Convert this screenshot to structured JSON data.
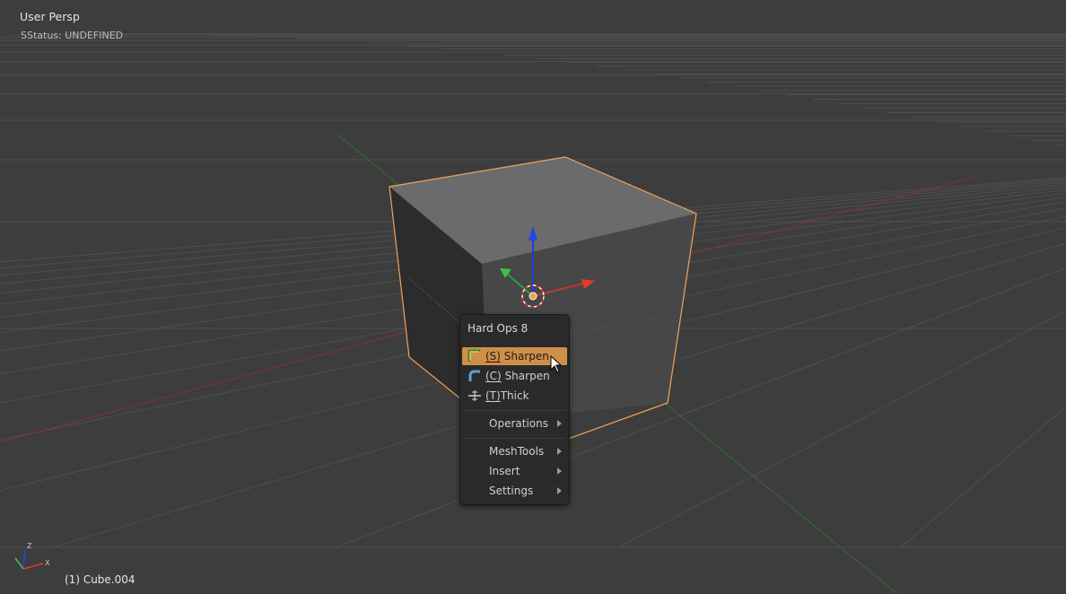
{
  "viewport": {
    "view_name": "User Persp",
    "status": "SStatus: UNDEFINED",
    "object": "(1) Cube.004",
    "axis_labels": {
      "z": "Z",
      "x": "X"
    }
  },
  "menu": {
    "title": "Hard Ops 8",
    "items": [
      {
        "key": "(S)",
        "label": " Sharpen",
        "icon": "sharpen-s-icon",
        "active": true
      },
      {
        "key": "(C)",
        "label": " Sharpen",
        "icon": "sharpen-c-icon",
        "active": false
      },
      {
        "key": "(T)",
        "label": "Thick",
        "icon": "thick-icon",
        "active": false
      }
    ],
    "submenus": [
      {
        "label": "Operations"
      },
      {
        "label": "MeshTools"
      },
      {
        "label": "Insert"
      },
      {
        "label": "Settings"
      }
    ]
  },
  "colors": {
    "background": "#3d3d3d",
    "grid": "#4d4d4d",
    "selection_outline": "#f2a35a",
    "menu_highlight": "#d08f48",
    "x_axis": "#c0392b",
    "y_axis": "#2e9e3a",
    "z_axis": "#1c3fd1"
  }
}
